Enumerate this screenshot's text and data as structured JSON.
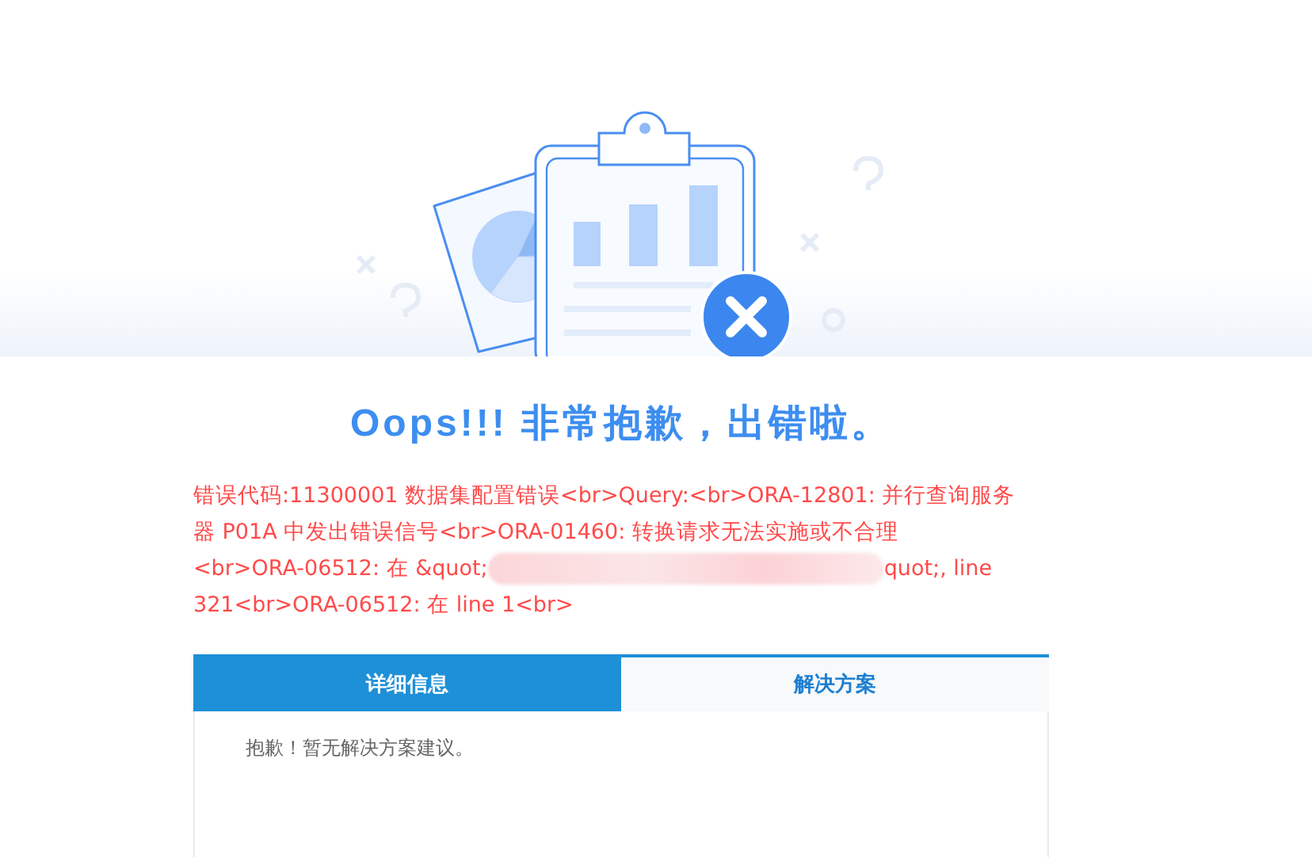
{
  "title": "Oops!!! 非常抱歉，出错啦。",
  "error_lines": [
    {
      "kind": "plain",
      "text": "错误代码:11300001 数据集配置错误<br>Query:<br>ORA-12801: 并行查询服务"
    },
    {
      "kind": "plain",
      "text": "器 P01A 中发出错误信号<br>ORA-01460: 转换请求无法实施或不合理"
    },
    {
      "kind": "redacted",
      "before": "<br>ORA-06512: 在 &quot;",
      "after": "quot;, line"
    },
    {
      "kind": "plain",
      "text": "321<br>ORA-06512: 在 line 1<br>"
    }
  ],
  "tabs": [
    {
      "label": "详细信息",
      "selected": true
    },
    {
      "label": "解决方案",
      "selected": false
    }
  ],
  "panel_text": "抱歉！暂无解决方案建议。"
}
